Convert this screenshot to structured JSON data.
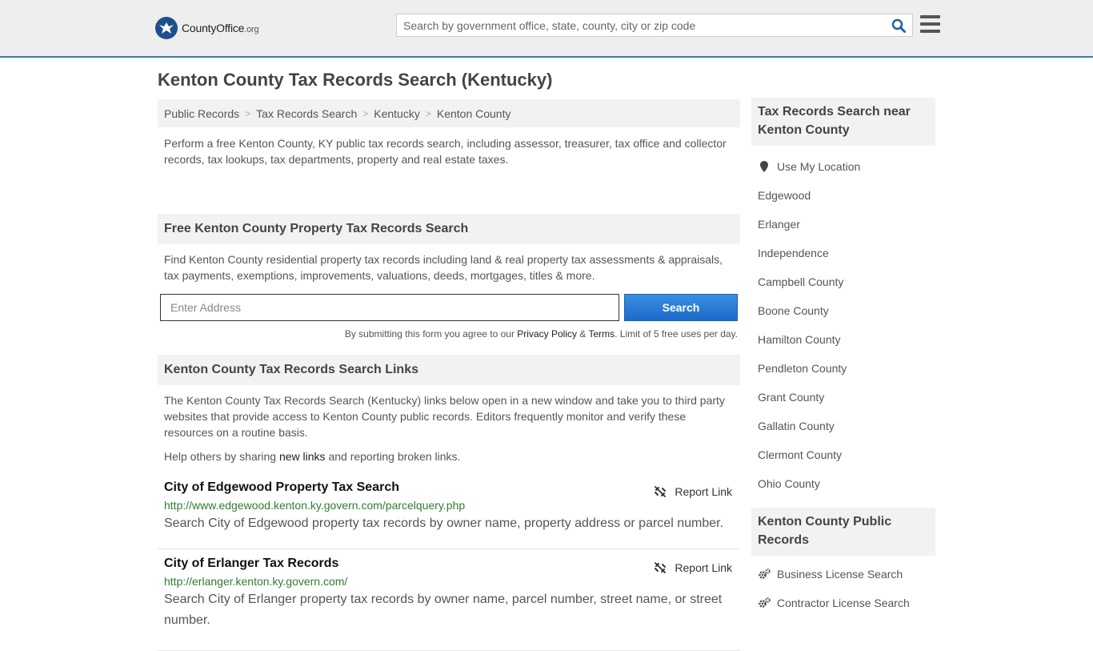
{
  "header": {
    "logo_text": "CountyOffice",
    "logo_suffix": ".org",
    "search_placeholder": "Search by government office, state, county, city or zip code"
  },
  "page_title": "Kenton County Tax Records Search (Kentucky)",
  "breadcrumb": [
    "Public Records",
    "Tax Records Search",
    "Kentucky",
    "Kenton County"
  ],
  "intro": "Perform a free Kenton County, KY public tax records search, including assessor, treasurer, tax office and collector records, tax lookups, tax departments, property and real estate taxes.",
  "property_search": {
    "heading": "Free Kenton County Property Tax Records Search",
    "description": "Find Kenton County residential property tax records including land & real property tax assessments & appraisals, tax payments, exemptions, improvements, valuations, deeds, mortgages, titles & more.",
    "address_placeholder": "Enter Address",
    "button_label": "Search",
    "disclaimer_pre": "By submitting this form you agree to our",
    "privacy_label": "Privacy Policy",
    "amp": "&",
    "terms_label": "Terms",
    "disclaimer_post": ". Limit of 5 free uses per day."
  },
  "links_section": {
    "heading": "Kenton County Tax Records Search Links",
    "description": "The Kenton County Tax Records Search (Kentucky) links below open in a new window and take you to third party websites that provide access to Kenton County public records. Editors frequently monitor and verify these resources on a routine basis.",
    "help_pre": "Help others by sharing",
    "help_link": "new links",
    "help_post": "and reporting broken links.",
    "report_label": "Report Link",
    "items": [
      {
        "title": "City of Edgewood Property Tax Search",
        "url": "http://www.edgewood.kenton.ky.govern.com/parcelquery.php",
        "description": "Search City of Edgewood property tax records by owner name, property address or parcel number."
      },
      {
        "title": "City of Erlanger Tax Records",
        "url": "http://erlanger.kenton.ky.govern.com/",
        "description": "Search City of Erlanger property tax records by owner name, parcel number, street name, or street number."
      }
    ]
  },
  "sidebar": {
    "nearby_heading": "Tax Records Search near Kenton County",
    "use_location": "Use My Location",
    "nearby": [
      "Edgewood",
      "Erlanger",
      "Independence",
      "Campbell County",
      "Boone County",
      "Hamilton County",
      "Pendleton County",
      "Grant County",
      "Gallatin County",
      "Clermont County",
      "Ohio County"
    ],
    "public_records_heading": "Kenton County Public Records",
    "public_records": [
      "Business License Search",
      "Contractor License Search"
    ]
  },
  "colors": {
    "accent": "#3d7ab8",
    "button": "#1c6ac9",
    "url_green": "#2e7d32"
  }
}
